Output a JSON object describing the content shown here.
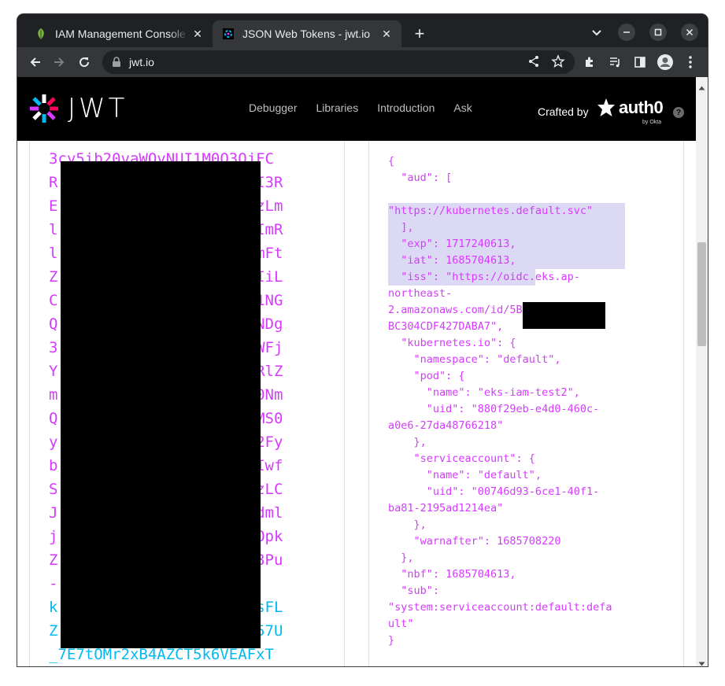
{
  "tabs": [
    {
      "title": "IAM Management Console",
      "active": false
    },
    {
      "title": "JSON Web Tokens - jwt.io",
      "active": true
    }
  ],
  "toolbar": {
    "url": "jwt.io"
  },
  "site": {
    "brand": "JWT",
    "nav": [
      "Debugger",
      "Libraries",
      "Introduction",
      "Ask"
    ],
    "crafted_by": "Crafted by",
    "sponsor": "auth0",
    "sponsor_sub": "by Okta",
    "help": "?"
  },
  "encoded_lines": [
    {
      "text": "3cy5ib20vaWQvNUI1M0Q3QjFC",
      "part": "payload"
    },
    {
      "text": "R                      I3R",
      "part": "payload"
    },
    {
      "text": "E                      zLm",
      "part": "payload"
    },
    {
      "text": "l                      ImR",
      "part": "payload"
    },
    {
      "text": "l                      mFt",
      "part": "payload"
    },
    {
      "text": "Z                      IiL",
      "part": "payload"
    },
    {
      "text": "C                      1NG",
      "part": "payload"
    },
    {
      "text": "Q                      NDg",
      "part": "payload"
    },
    {
      "text": "3                      WFj",
      "part": "payload"
    },
    {
      "text": "Y                      RlZ",
      "part": "payload"
    },
    {
      "text": "m                      0Nm",
      "part": "payload"
    },
    {
      "text": "Q                      MS0",
      "part": "payload"
    },
    {
      "text": "y                      2Fy",
      "part": "payload"
    },
    {
      "text": "b                      Iwf",
      "part": "payload"
    },
    {
      "text": "S                      zLC",
      "part": "payload"
    },
    {
      "text": "J                      dml",
      "part": "payload"
    },
    {
      "text": "j                      Opk",
      "part": "payload"
    },
    {
      "text": "Z                      3Pu",
      "part": "payload"
    },
    {
      "text": "-",
      "part": "payload"
    },
    {
      "text": "k                      sFL",
      "part": "signature"
    },
    {
      "text": "Z                      57U",
      "part": "signature"
    },
    {
      "text": "_7E7tOMr2xB4AZCT5k6VEAFxT",
      "part": "signature"
    }
  ],
  "decoded_lines": [
    "{",
    "  \"aud\": [",
    "",
    "\"https://kubernetes.default.svc\"",
    "  ],",
    "  \"exp\": 1717240613,",
    "  \"iat\": 1685704613,",
    "  \"iss\": \"https://oidc.eks.ap-",
    "northeast-",
    "2.amazonaws.com/id/5B           53",
    "BC304CDF427DABA7\",",
    "  \"kubernetes.io\": {",
    "    \"namespace\": \"default\",",
    "    \"pod\": {",
    "      \"name\": \"eks-iam-test2\",",
    "      \"uid\": \"880f29eb-e4d0-460c-",
    "a0e6-27da48766218\"",
    "    },",
    "    \"serviceaccount\": {",
    "      \"name\": \"default\",",
    "      \"uid\": \"00746d93-6ce1-40f1-",
    "ba81-2195ad1214ea\"",
    "    },",
    "    \"warnafter\": 1685708220",
    "  },",
    "  \"nbf\": 1685704613,",
    "  \"sub\":",
    "\"system:serviceaccount:default:defa",
    "ult\"",
    "}"
  ],
  "colors": {
    "payload": "#d63aff",
    "signature": "#00b9f1",
    "selection": "#dcd9f5"
  }
}
